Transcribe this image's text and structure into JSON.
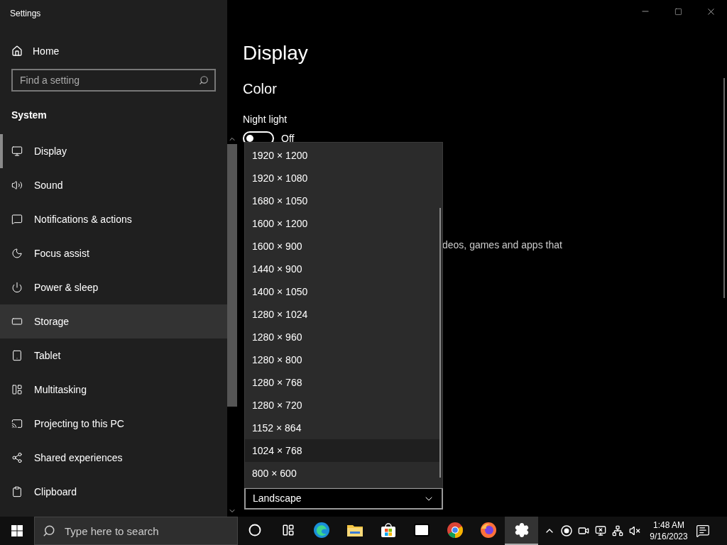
{
  "window": {
    "title": "Settings"
  },
  "sidebar": {
    "home": "Home",
    "search": {
      "placeholder": "Find a setting"
    },
    "section": "System",
    "items": [
      {
        "label": "Display",
        "selected": true,
        "hovered": false
      },
      {
        "label": "Sound",
        "selected": false,
        "hovered": false
      },
      {
        "label": "Notifications & actions",
        "selected": false,
        "hovered": false
      },
      {
        "label": "Focus assist",
        "selected": false,
        "hovered": false
      },
      {
        "label": "Power & sleep",
        "selected": false,
        "hovered": false
      },
      {
        "label": "Storage",
        "selected": false,
        "hovered": true
      },
      {
        "label": "Tablet",
        "selected": false,
        "hovered": false
      },
      {
        "label": "Multitasking",
        "selected": false,
        "hovered": false
      },
      {
        "label": "Projecting to this PC",
        "selected": false,
        "hovered": false
      },
      {
        "label": "Shared experiences",
        "selected": false,
        "hovered": false
      },
      {
        "label": "Clipboard",
        "selected": false,
        "hovered": false
      }
    ]
  },
  "content": {
    "title": "Display",
    "section": "Color",
    "night_light": {
      "label": "Night light",
      "on": false,
      "state_text": "Off"
    },
    "fragment": "deos, games and apps that",
    "orientation": {
      "value": "Landscape"
    }
  },
  "resolution_list": [
    {
      "label": "1920 × 1200",
      "selected": false
    },
    {
      "label": "1920 × 1080",
      "selected": false
    },
    {
      "label": "1680 × 1050",
      "selected": false
    },
    {
      "label": "1600 × 1200",
      "selected": false
    },
    {
      "label": "1600 × 900",
      "selected": false
    },
    {
      "label": "1440 × 900",
      "selected": false
    },
    {
      "label": "1400 × 1050",
      "selected": false
    },
    {
      "label": "1280 × 1024",
      "selected": false
    },
    {
      "label": "1280 × 960",
      "selected": false
    },
    {
      "label": "1280 × 800",
      "selected": false
    },
    {
      "label": "1280 × 768",
      "selected": false
    },
    {
      "label": "1280 × 720",
      "selected": false
    },
    {
      "label": "1152 × 864",
      "selected": false
    },
    {
      "label": "1024 × 768",
      "selected": true
    },
    {
      "label": "800 × 600",
      "selected": false
    }
  ],
  "taskbar": {
    "search": {
      "placeholder": "Type here to search"
    },
    "apps": [
      {
        "kind": "cortana",
        "active": false
      },
      {
        "kind": "taskview",
        "active": false
      },
      {
        "kind": "edge",
        "active": false
      },
      {
        "kind": "explorer",
        "active": false
      },
      {
        "kind": "store",
        "active": false
      },
      {
        "kind": "mail",
        "active": false
      },
      {
        "kind": "chrome",
        "active": false
      },
      {
        "kind": "firefox",
        "active": false
      },
      {
        "kind": "settings",
        "active": true
      }
    ],
    "time": "1:48 AM",
    "date": "9/16/2023"
  }
}
